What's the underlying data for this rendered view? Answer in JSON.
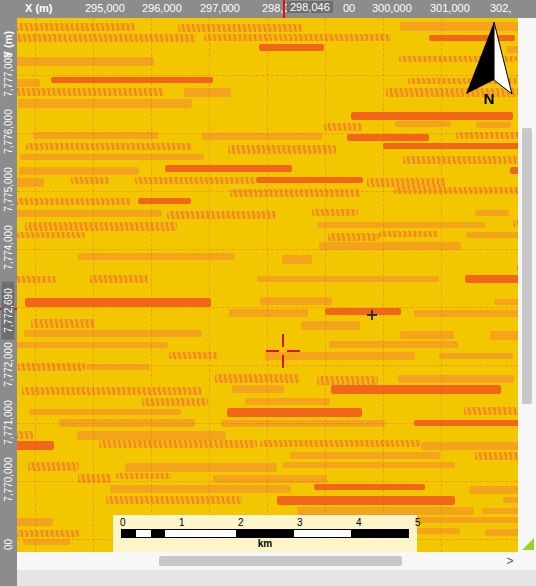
{
  "axes": {
    "x": {
      "title": "X (m)",
      "ticks": [
        "295,000",
        "296,000",
        "297,000",
        "298,0",
        "00",
        "300,000",
        "301,000",
        "302,"
      ],
      "cursor": "298,046"
    },
    "y": {
      "title": "Y (m)",
      "ticks": [
        "7,777,000",
        "7,776,000",
        "7,775,000",
        "7,774,000",
        "7,772,000",
        "7,771,000",
        "7,770,000",
        "00"
      ],
      "cursor": "7,772,690"
    }
  },
  "north_arrow": {
    "label": "N"
  },
  "scale_bar": {
    "ticks": [
      "0",
      "1",
      "2",
      "3",
      "4",
      "5"
    ],
    "unit": "km"
  },
  "scrollbars": {
    "left": "<",
    "right": ">"
  }
}
